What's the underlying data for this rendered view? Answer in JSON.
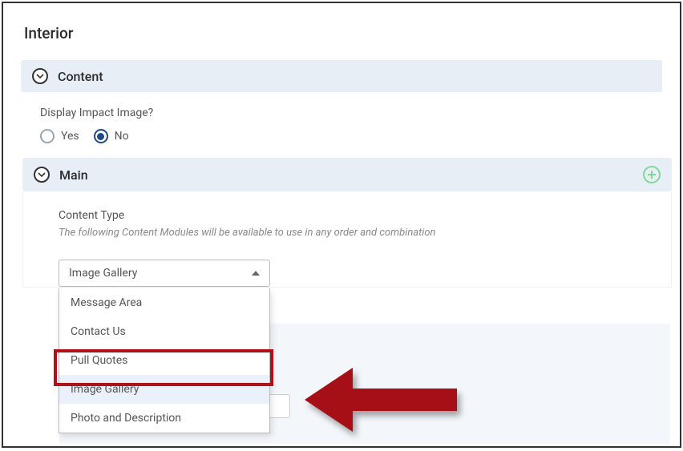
{
  "page": {
    "title": "Interior"
  },
  "sections": {
    "content": {
      "label": "Content"
    },
    "main": {
      "label": "Main"
    }
  },
  "impact": {
    "question": "Display Impact Image?",
    "options": {
      "yes": "Yes",
      "no": "No"
    },
    "selected": "No"
  },
  "content_type": {
    "label": "Content Type",
    "help": "The following Content Modules will be available to use in any order and combination",
    "selected": "Image Gallery",
    "options": [
      "Message Area",
      "Contact Us",
      "Pull Quotes",
      "Image Gallery",
      "Photo and Description"
    ],
    "highlighted_option": "Image Gallery"
  },
  "icons": {
    "chevron": "chevron-down-icon",
    "add": "add-icon",
    "arrow_annotation": "red-arrow-annotation"
  }
}
